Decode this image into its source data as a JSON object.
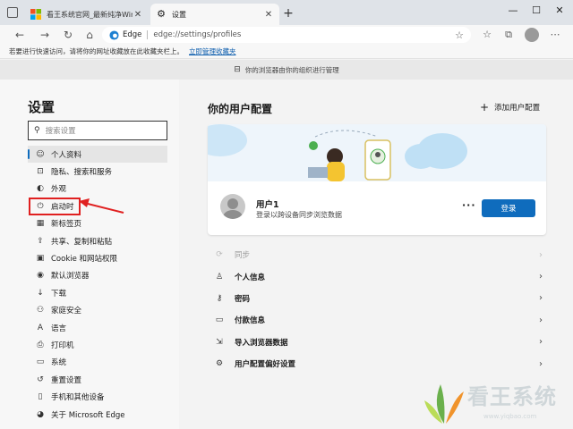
{
  "tabs": [
    {
      "title": "看王系统官网_最新纯净Win10系统",
      "active": false
    },
    {
      "title": "设置",
      "active": true
    }
  ],
  "address": {
    "edge_label": "Edge",
    "url": "edge://settings/profiles"
  },
  "favbar": {
    "text": "若要进行快速访问，请将你的网址收藏放在此收藏夹栏上。",
    "link": "立即管理收藏夹"
  },
  "managed_text": "你的浏览器由你的组织进行管理",
  "sidebar": {
    "title": "设置",
    "search_placeholder": "搜索设置",
    "items": [
      {
        "label": "个人资料",
        "icon": "profile-icon",
        "active": true
      },
      {
        "label": "隐私、搜索和服务",
        "icon": "lock-icon"
      },
      {
        "label": "外观",
        "icon": "appearance-icon"
      },
      {
        "label": "启动时",
        "icon": "power-icon"
      },
      {
        "label": "新标签页",
        "icon": "newtab-icon"
      },
      {
        "label": "共享、复制和粘贴",
        "icon": "share-icon"
      },
      {
        "label": "Cookie 和网站权限",
        "icon": "cookie-icon"
      },
      {
        "label": "默认浏览器",
        "icon": "browser-icon"
      },
      {
        "label": "下载",
        "icon": "download-icon"
      },
      {
        "label": "家庭安全",
        "icon": "family-icon"
      },
      {
        "label": "语言",
        "icon": "language-icon"
      },
      {
        "label": "打印机",
        "icon": "printer-icon"
      },
      {
        "label": "系统",
        "icon": "system-icon"
      },
      {
        "label": "重置设置",
        "icon": "reset-icon"
      },
      {
        "label": "手机和其他设备",
        "icon": "phone-icon"
      },
      {
        "label": "关于 Microsoft Edge",
        "icon": "edge-icon"
      }
    ]
  },
  "main": {
    "title": "你的用户配置",
    "add_profile": "添加用户配置",
    "user_name": "用户1",
    "user_sub": "登录以跨设备同步浏览数据",
    "signin_label": "登录",
    "rows": [
      {
        "label": "同步",
        "icon": "sync-icon",
        "muted": true
      },
      {
        "label": "个人信息",
        "icon": "person-icon"
      },
      {
        "label": "密码",
        "icon": "key-icon"
      },
      {
        "label": "付款信息",
        "icon": "card-icon"
      },
      {
        "label": "导入浏览器数据",
        "icon": "import-icon"
      },
      {
        "label": "用户配置偏好设置",
        "icon": "profile-settings-icon"
      }
    ]
  },
  "watermark": {
    "text": "看王系统",
    "sub": "www.yiqbao.com"
  },
  "colors": {
    "accent": "#0f6cbd",
    "highlight": "#e02020"
  }
}
